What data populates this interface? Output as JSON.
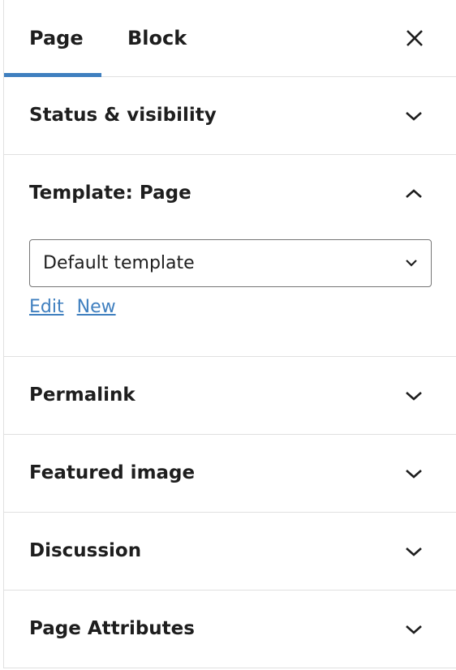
{
  "tabs": {
    "page_label": "Page",
    "block_label": "Block",
    "active": "Page"
  },
  "colors": {
    "accent": "#3f7fbf",
    "text": "#1e1e1e",
    "divider": "#e0e0e0"
  },
  "panels": {
    "status": {
      "title": "Status & visibility",
      "expanded": false
    },
    "template": {
      "title": "Template: Page",
      "expanded": true,
      "select_value": "Default template",
      "edit_label": "Edit",
      "new_label": "New"
    },
    "permalink": {
      "title": "Permalink",
      "expanded": false
    },
    "featured": {
      "title": "Featured image",
      "expanded": false
    },
    "discussion": {
      "title": "Discussion",
      "expanded": false
    },
    "attributes": {
      "title": "Page Attributes",
      "expanded": false
    }
  },
  "icons": {
    "close": "close-icon",
    "collapsed": "chevron-down-icon",
    "expanded": "chevron-up-icon"
  }
}
